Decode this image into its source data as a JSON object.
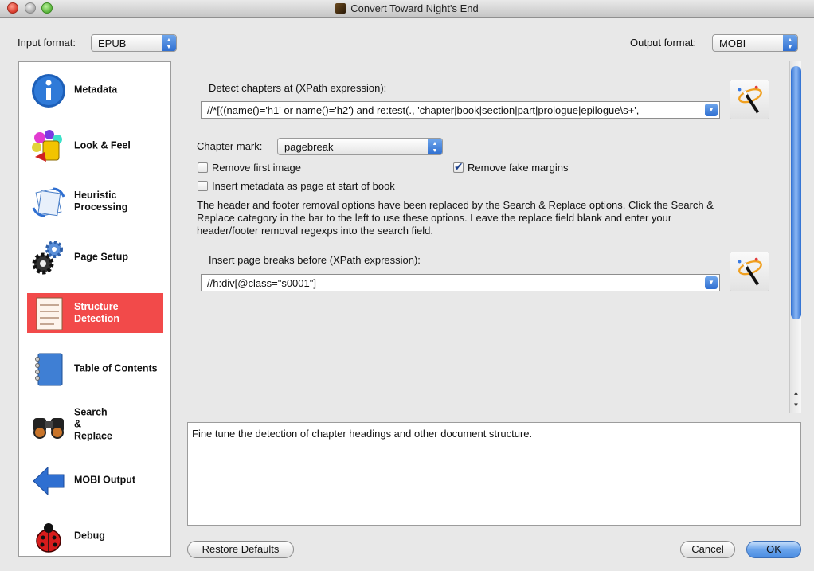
{
  "window": {
    "title": "Convert Toward Night's End"
  },
  "formats": {
    "input_label": "Input format:",
    "input_value": "EPUB",
    "output_label": "Output format:",
    "output_value": "MOBI"
  },
  "sidebar": {
    "items": [
      {
        "label": "Metadata",
        "icon": "info-icon",
        "selected": false
      },
      {
        "label": "Look & Feel",
        "icon": "palette-icon",
        "selected": false
      },
      {
        "label": "Heuristic Processing",
        "icon": "heuristic-icon",
        "selected": false
      },
      {
        "label": "Page Setup",
        "icon": "gears-icon",
        "selected": false
      },
      {
        "label": "Structure Detection",
        "icon": "document-icon",
        "selected": true
      },
      {
        "label": "Table of Contents",
        "icon": "notebook-icon",
        "selected": false
      },
      {
        "label": "Search & Replace",
        "icon": "binoculars-icon",
        "selected": false
      },
      {
        "label": "MOBI Output",
        "icon": "arrow-left-icon",
        "selected": false
      },
      {
        "label": "Debug",
        "icon": "ladybug-icon",
        "selected": false
      }
    ]
  },
  "structure": {
    "chapters_label": "Detect chapters at (XPath expression):",
    "chapters_value": "//*[((name()='h1' or name()='h2') and re:test(., 'chapter|book|section|part|prologue|epilogue\\s+',",
    "chapter_mark_label": "Chapter mark:",
    "chapter_mark_value": "pagebreak",
    "remove_first_image_label": "Remove first image",
    "remove_first_image_checked": false,
    "remove_fake_margins_label": "Remove fake margins",
    "remove_fake_margins_checked": true,
    "insert_metadata_label": "Insert metadata as page at start of book",
    "insert_metadata_checked": false,
    "header_footer_note_line1": "The header and footer removal options have been replaced by the Search & Replace options. Click the Search &",
    "header_footer_note_line2": "Replace category in the bar to the left to use these options. Leave the replace field blank and enter your",
    "header_footer_note_line3": "header/footer removal regexps into the search field.",
    "page_breaks_label": "Insert page breaks before (XPath expression):",
    "page_breaks_value": "//h:div[@class=\"s0001\"]"
  },
  "description": "Fine tune the detection of chapter headings and other document structure.",
  "buttons": {
    "restore_defaults": "Restore Defaults",
    "cancel": "Cancel",
    "ok": "OK"
  }
}
